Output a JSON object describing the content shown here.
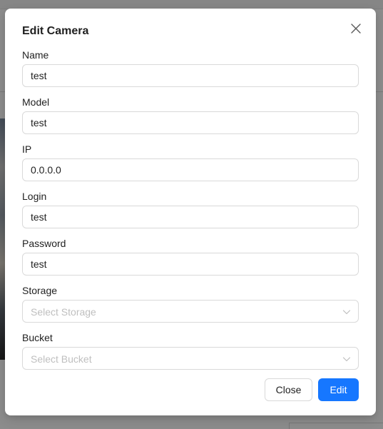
{
  "modal": {
    "title": "Edit Camera",
    "close_icon": "close-icon"
  },
  "fields": {
    "name": {
      "label": "Name",
      "value": "test"
    },
    "model": {
      "label": "Model",
      "value": "test"
    },
    "ip": {
      "label": "IP",
      "value": "0.0.0.0"
    },
    "login": {
      "label": "Login",
      "value": "test"
    },
    "password": {
      "label": "Password",
      "value": "test"
    },
    "storage": {
      "label": "Storage",
      "placeholder": "Select Storage",
      "icon": "chevron-down-icon"
    },
    "bucket": {
      "label": "Bucket",
      "placeholder": "Select Bucket",
      "icon": "chevron-down-icon"
    }
  },
  "footer": {
    "close_label": "Close",
    "edit_label": "Edit"
  },
  "colors": {
    "primary": "#1677ff",
    "border": "#d9d9d9",
    "placeholder": "#bfbfbf",
    "text": "#1f1f1f"
  }
}
